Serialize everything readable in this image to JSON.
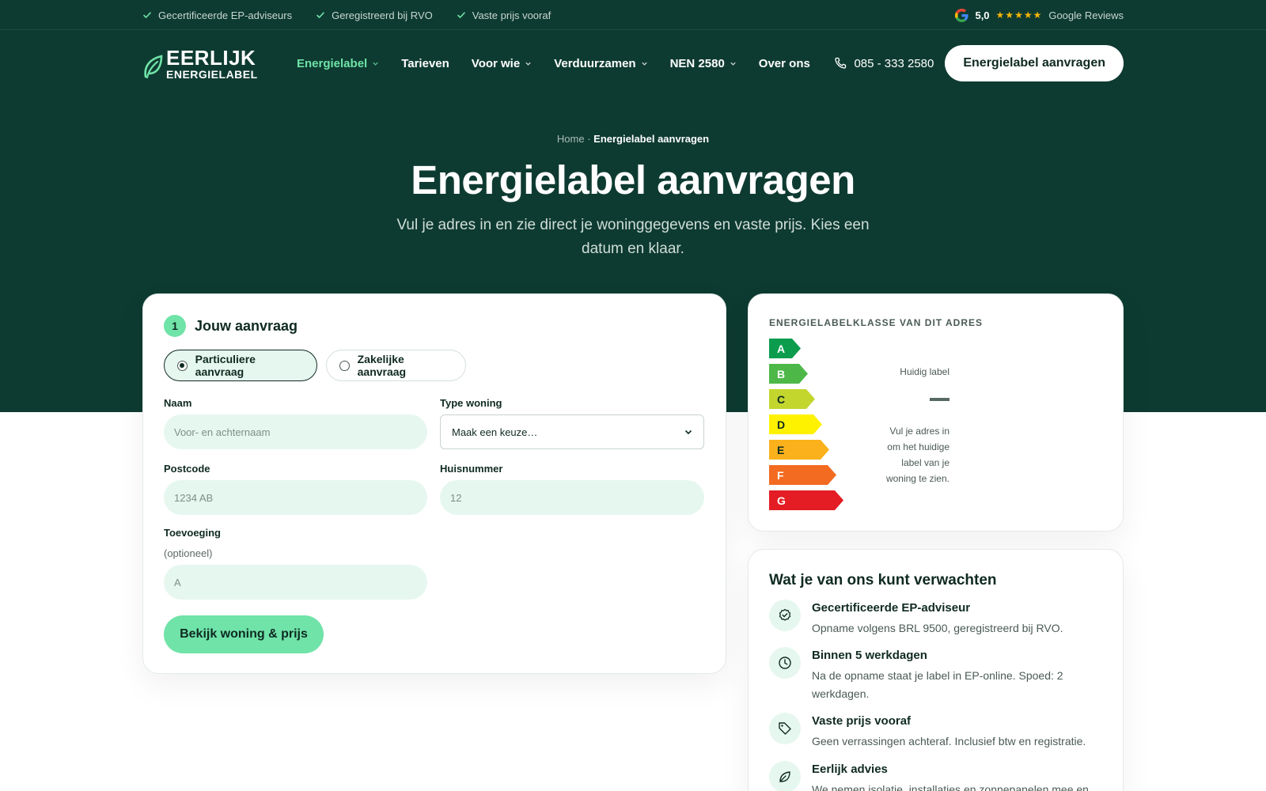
{
  "topbar": {
    "usps": [
      "Gecertificeerde EP-adviseurs",
      "Geregistreerd bij RVO",
      "Vaste prijs vooraf"
    ],
    "rating": "5,0",
    "reviews_label": "Google Reviews"
  },
  "logo": {
    "line1": "EERLIJK",
    "line2": "ENERGIELABEL"
  },
  "nav": {
    "items": [
      {
        "label": "Energielabel",
        "dropdown": true,
        "active": true
      },
      {
        "label": "Tarieven",
        "dropdown": false
      },
      {
        "label": "Voor wie",
        "dropdown": true
      },
      {
        "label": "Verduurzamen",
        "dropdown": true
      },
      {
        "label": "NEN 2580",
        "dropdown": true
      },
      {
        "label": "Over ons",
        "dropdown": false
      }
    ],
    "phone": "085 - 333 2580",
    "cta": "Energielabel aanvragen"
  },
  "hero": {
    "breadcrumb_home": "Home",
    "breadcrumb_sep": "·",
    "breadcrumb_current": "Energielabel aanvragen",
    "title": "Energielabel aanvragen",
    "subtitle": "Vul je adres in en zie direct je woninggegevens en vaste prijs. Kies een datum en klaar."
  },
  "form": {
    "step_number": "1",
    "step_title": "Jouw aanvraag",
    "type_private": "Particuliere aanvraag",
    "type_business": "Zakelijke aanvraag",
    "naam_label": "Naam",
    "naam_placeholder": "Voor- en achternaam",
    "type_woning_label": "Type woning",
    "type_woning_value": "Maak een keuze…",
    "postcode_label": "Postcode",
    "postcode_placeholder": "1234 AB",
    "huisnummer_label": "Huisnummer",
    "huisnummer_placeholder": "12",
    "toevoeging_label": "Toevoeging",
    "toevoeging_sub": "(optioneel)",
    "toevoeging_placeholder": "A",
    "submit": "Bekijk woning & prijs"
  },
  "label_card": {
    "title": "ENERGIELABELKLASSE VAN DIT ADRES",
    "classes": [
      {
        "letter": "A",
        "color": "#0b9c4e"
      },
      {
        "letter": "B",
        "color": "#4db848"
      },
      {
        "letter": "C",
        "color": "#c2d62e"
      },
      {
        "letter": "D",
        "color": "#fff200"
      },
      {
        "letter": "E",
        "color": "#fbb11c"
      },
      {
        "letter": "F",
        "color": "#f26b21"
      },
      {
        "letter": "G",
        "color": "#e31d23"
      }
    ],
    "current_label": "Huidig label",
    "current_note": "Vul je adres in om het huidige label van je woning te zien."
  },
  "expect": {
    "title": "Wat je van ons kunt verwachten",
    "items": [
      {
        "icon": "badge-check-icon",
        "title": "Gecertificeerde EP-adviseur",
        "text": "Opname volgens BRL 9500, geregistreerd bij RVO."
      },
      {
        "icon": "clock-icon",
        "title": "Binnen 5 werkdagen",
        "text": "Na de opname staat je label in EP-online. Spoed: 2 werkdagen."
      },
      {
        "icon": "tag-icon",
        "title": "Vaste prijs vooraf",
        "text": "Geen verrassingen achteraf. Inclusief btw en registratie."
      },
      {
        "icon": "leaf-icon",
        "title": "Eerlijk advies",
        "text": "We nemen isolatie, installaties en zonnepanelen mee en"
      }
    ]
  },
  "colors": {
    "dark_green": "#0e3b31",
    "mint": "#6fe3a8",
    "mint_light": "#e6f7ef"
  }
}
